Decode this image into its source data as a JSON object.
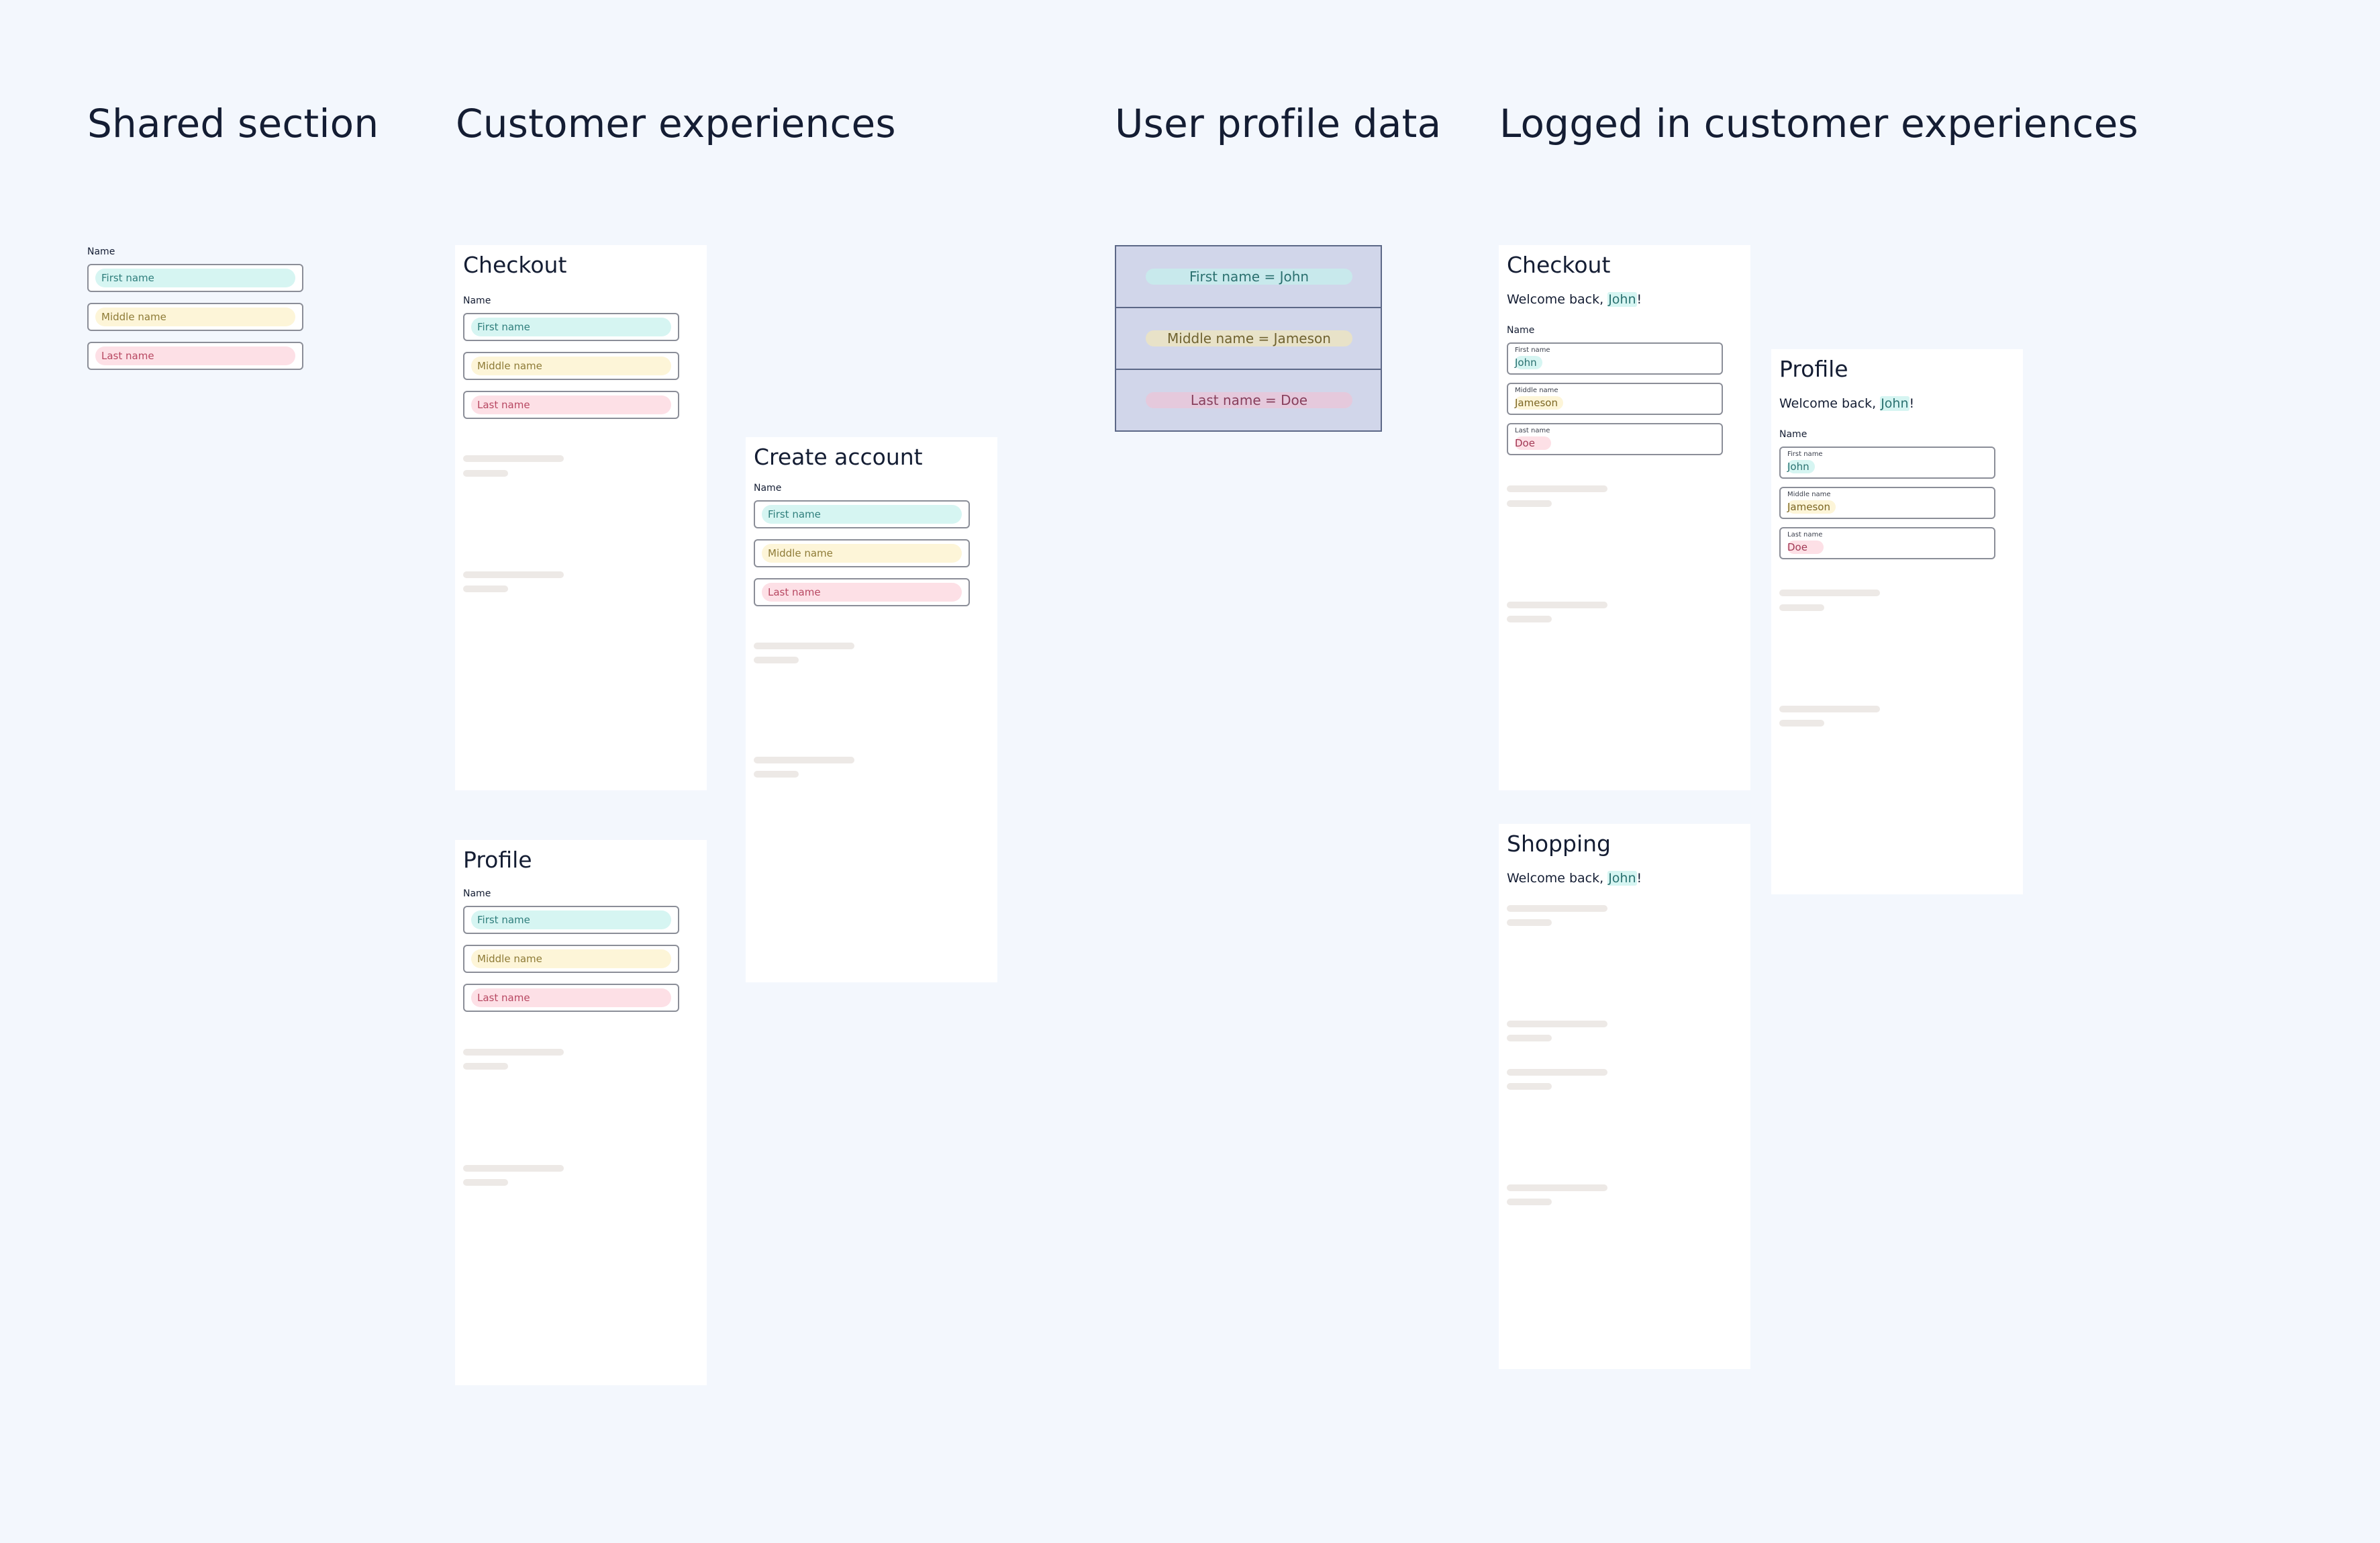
{
  "headings": {
    "shared": "Shared section",
    "customer": "Customer experiences",
    "user_profile": "User profile data",
    "logged_in": "Logged in customer experiences"
  },
  "form": {
    "section_label": "Name",
    "first_placeholder": "First name",
    "middle_placeholder": "Middle name",
    "last_placeholder": "Last name"
  },
  "cards": {
    "checkout": "Checkout",
    "profile": "Profile",
    "create_account": "Create account",
    "shopping": "Shopping"
  },
  "user_profile": {
    "first": "First name = John",
    "middle": "Middle name = Jameson",
    "last": "Last name = Doe"
  },
  "user": {
    "first": "John",
    "middle": "Jameson",
    "last": "Doe"
  },
  "welcome": {
    "prefix": "Welcome back, ",
    "suffix": "!"
  },
  "colors": {
    "background": "#f3f7fd",
    "first_name": "#d6f5f2",
    "middle_name": "#fdf5d8",
    "last_name": "#fde0e6",
    "profile_box": "#d1d6ea"
  }
}
